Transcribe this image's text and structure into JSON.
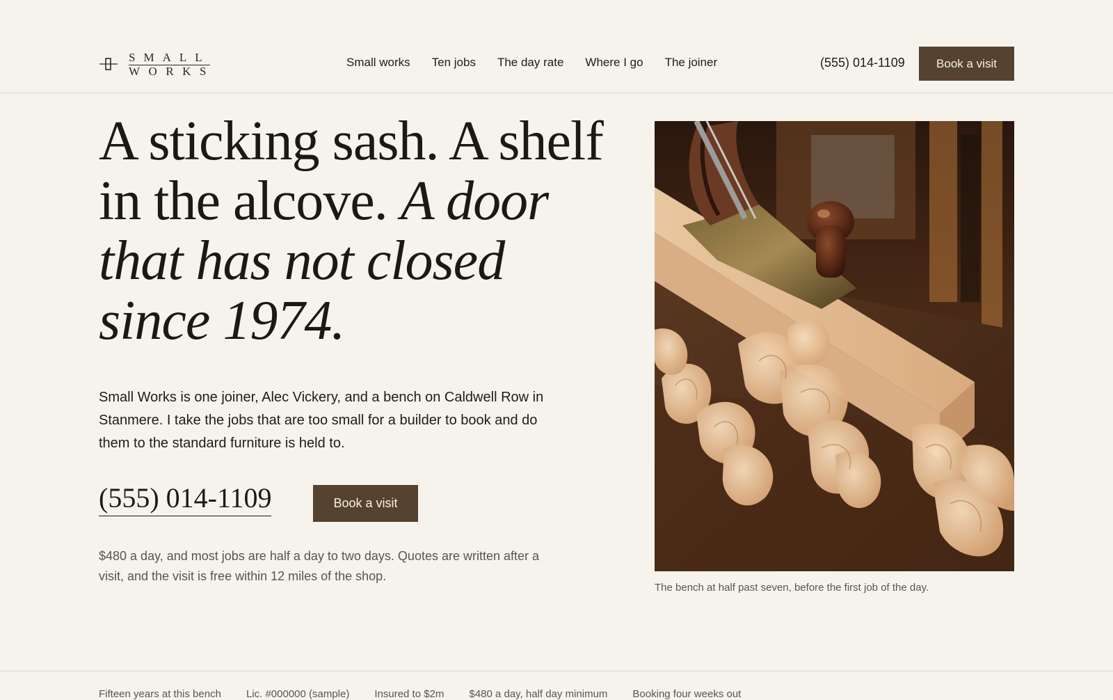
{
  "brand": {
    "line1": "SMALL",
    "line2": "WORKS",
    "icon": "plane-mark-icon"
  },
  "nav": {
    "items": [
      {
        "label": "Small works"
      },
      {
        "label": "Ten jobs"
      },
      {
        "label": "The day rate"
      },
      {
        "label": "Where I go"
      },
      {
        "label": "The joiner"
      }
    ]
  },
  "header": {
    "phone": "(555) 014-1109",
    "cta_label": "Book a visit"
  },
  "hero": {
    "title_plain": "A sticking sash. A shelf in the alcove. ",
    "title_italic": "A door that has not closed since 1974.",
    "intro": "Small Works is one joiner, Alec Vickery, and a bench on Caldwell Row in Stanmere. I take the jobs that are too small for a builder to book and do them to the standard furniture is held to.",
    "phone": "(555) 014-1109",
    "cta_label": "Book a visit",
    "note": "$480 a day, and most jobs are half a day to two days. Quotes are written after a visit, and the visit is free within 12 miles of the shop."
  },
  "photo": {
    "caption": "The bench at half past seven, before the first job of the day."
  },
  "strip": {
    "items": [
      "Fifteen years at this bench",
      "Lic. #000000 (sample)",
      "Insured to $2m",
      "$480 a day, half day minimum",
      "Booking four weeks out"
    ]
  },
  "colors": {
    "background": "#f6f3ed",
    "accent": "#55422f",
    "text": "#1f1b17",
    "muted": "#5b544c"
  }
}
